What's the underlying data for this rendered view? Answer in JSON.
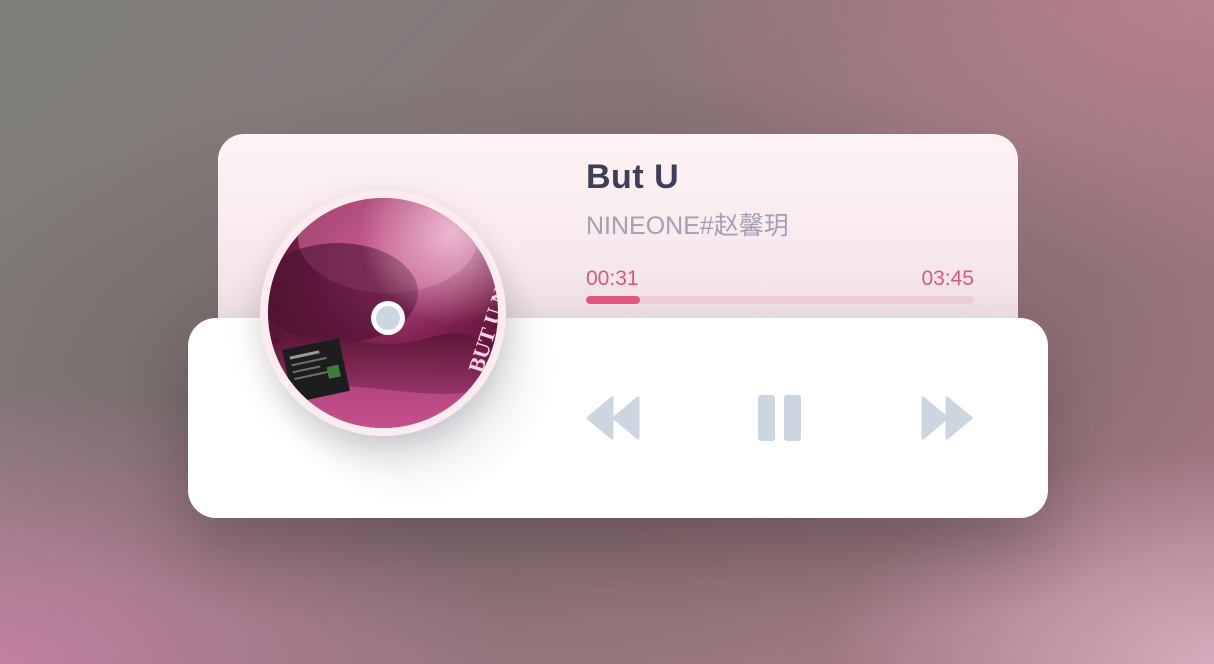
{
  "track": {
    "title": "But U",
    "artist": "NINEONE#赵馨玥",
    "cover_text": "BUT U NINEONE#"
  },
  "progress": {
    "current_time": "00:31",
    "total_time": "03:45",
    "fraction": 0.14
  },
  "controls": {
    "prev_icon": "rewind-icon",
    "pause_icon": "pause-icon",
    "next_icon": "fast-forward-icon"
  },
  "colors": {
    "accent": "#e0567f",
    "icon": "#ccd6e0",
    "title": "#3e3d5a",
    "artist": "#a3a0b6"
  }
}
